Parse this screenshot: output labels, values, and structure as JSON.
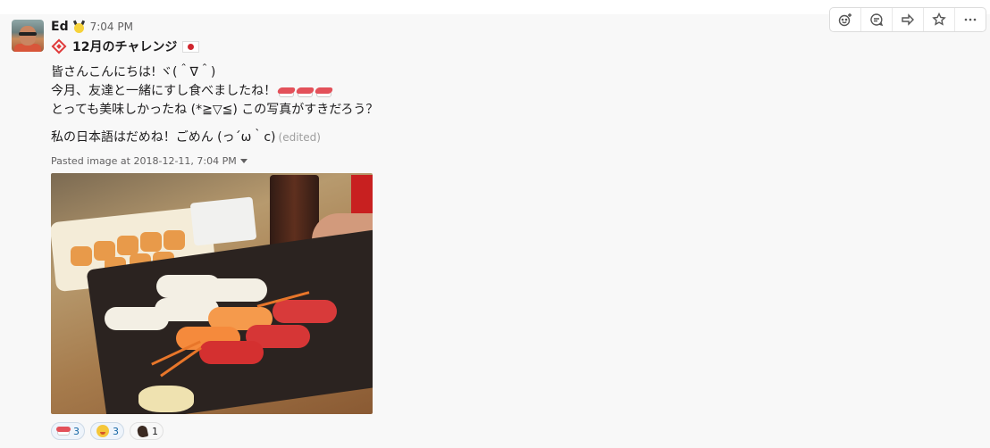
{
  "message": {
    "sender": "Ed",
    "time": "7:04 PM",
    "status": {
      "text": "12月のチャレンジ"
    },
    "lines": [
      "皆さんこんにちは! ヾ(＾∇＾)",
      "今月、友達と一緒にすし食べましたね！",
      "とっても美味しかったね (*≧▽≦) この写真がすきだろう？",
      "私の日本語はだめね！ごめん (っ´ω｀c)"
    ],
    "edited_label": "(edited)",
    "pasted_label": "Pasted image at 2018-12-11, 7:04 PM"
  },
  "reactions": [
    {
      "icon": "sushi-icon",
      "count": "3"
    },
    {
      "icon": "yum-face-icon",
      "count": "3"
    },
    {
      "icon": "horse-head-icon",
      "count": "1"
    }
  ],
  "toolbar": {
    "actions": [
      "add-reaction",
      "start-thread",
      "share-message",
      "save-star",
      "more-actions"
    ]
  },
  "colors": {
    "message_bg": "#f8f8f8",
    "reaction_bg": "#eef4fb",
    "reaction_text": "#1264a3",
    "accent_red": "#e03a3a"
  }
}
